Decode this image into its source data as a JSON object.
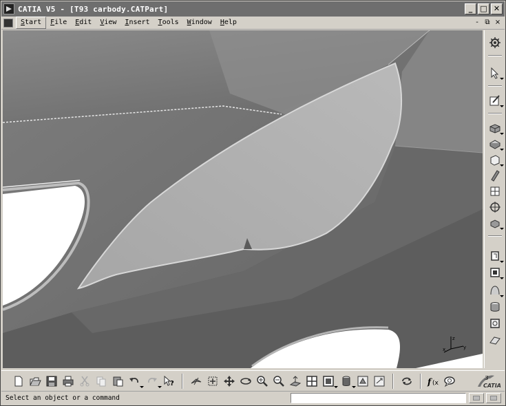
{
  "window": {
    "title": "CATIA V5 - [T93 carbody.CATPart]",
    "controls": {
      "minimize": "_",
      "maximize": "□",
      "close": "✕"
    }
  },
  "menubar": {
    "items": [
      {
        "label": "Start",
        "accel": "S",
        "rest": "tart"
      },
      {
        "label": "File",
        "accel": "F",
        "rest": "ile"
      },
      {
        "label": "Edit",
        "accel": "E",
        "rest": "dit"
      },
      {
        "label": "View",
        "accel": "V",
        "rest": "iew"
      },
      {
        "label": "Insert",
        "accel": "I",
        "rest": "nsert"
      },
      {
        "label": "Tools",
        "accel": "T",
        "rest": "ools"
      },
      {
        "label": "Window",
        "accel": "W",
        "rest": "indow"
      },
      {
        "label": "Help",
        "accel": "H",
        "rest": "elp"
      }
    ],
    "mdi_controls": {
      "minimize": "-",
      "restore": "⧉",
      "close": "×"
    }
  },
  "viewport": {
    "model": "car body panel with headlamp opening",
    "compass_axes": {
      "x": "x",
      "y": "y",
      "z": "z"
    }
  },
  "right_toolbar": {
    "icons": [
      "gear-icon",
      "select-arrow-icon",
      "sketcher-icon",
      "pad-icon",
      "pocket-icon",
      "shaft-icon",
      "rib-icon",
      "stiffener-icon",
      "hole-icon",
      "solid-combine-icon",
      "fillet-icon",
      "chamfer-icon",
      "draft-icon",
      "shell-icon",
      "thickness-icon",
      "thread-icon"
    ]
  },
  "bottom_toolbar": {
    "icons": [
      "new-icon",
      "open-icon",
      "save-icon",
      "print-icon",
      "cut-icon",
      "copy-icon",
      "paste-icon",
      "undo-icon",
      "redo-icon",
      "whats-this-icon",
      "fly-mode-icon",
      "fit-all-icon",
      "pan-icon",
      "rotate-icon",
      "zoom-in-icon",
      "zoom-out-icon",
      "normal-view-icon",
      "multi-view-icon",
      "quick-view-icon",
      "shading-icon",
      "hide-show-icon",
      "swap-space-icon",
      "update-icon",
      "formula-icon",
      "knowledge-icon"
    ],
    "brand": "CATIA"
  },
  "statusbar": {
    "message": "Select an object or a command",
    "command_value": ""
  },
  "colors": {
    "chrome": "#d4d0c8",
    "titlebar": "#6e6e6e",
    "surface_dark": "#6a6a6a",
    "surface_light": "#a8a8a8",
    "lamp": "#b0b0b0"
  }
}
